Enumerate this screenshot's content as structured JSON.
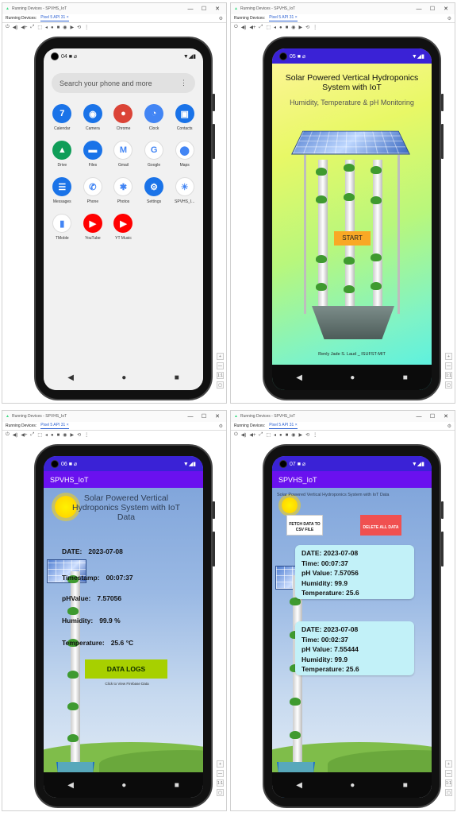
{
  "window": {
    "title": "Running Devices - SPVHS_IoT",
    "devices_label": "Running Devices:",
    "device_tab": "Pixel 5 API 31",
    "close_tab": "×",
    "min": "—",
    "max": "☐",
    "close": "✕"
  },
  "toolbar_glyphs": [
    "⏻",
    "◀)",
    "◀+",
    "⤢",
    "⬚",
    "◂",
    "●",
    "■",
    "◉",
    "▶",
    "⟲",
    "⋮"
  ],
  "side_glyphs": [
    "+",
    "—",
    "1:1",
    "▢"
  ],
  "home": {
    "status_time": "04",
    "status_icons_left": "■ ⌀",
    "status_icons_right": "▼◢▮",
    "search_placeholder": "Search your phone and more",
    "search_menu": "⋮",
    "apps": [
      {
        "label": "Calendar",
        "icon": "calendar-icon",
        "color": "#1a73e8",
        "glyph": "7"
      },
      {
        "label": "Camera",
        "icon": "camera-icon",
        "color": "#1a73e8",
        "glyph": "◉"
      },
      {
        "label": "Chrome",
        "icon": "chrome-icon",
        "color": "#db4437",
        "glyph": "●"
      },
      {
        "label": "Clock",
        "icon": "clock-icon",
        "color": "#4285f4",
        "glyph": "◔"
      },
      {
        "label": "Contacts",
        "icon": "contacts-icon",
        "color": "#1a73e8",
        "glyph": "▣"
      },
      {
        "label": "Drive",
        "icon": "drive-icon",
        "color": "#0f9d58",
        "glyph": "▲"
      },
      {
        "label": "Files",
        "icon": "files-icon",
        "color": "#1a73e8",
        "glyph": "▬"
      },
      {
        "label": "Gmail",
        "icon": "gmail-icon",
        "color": "#ffffff",
        "glyph": "M"
      },
      {
        "label": "Google",
        "icon": "google-icon",
        "color": "#ffffff",
        "glyph": "G"
      },
      {
        "label": "Maps",
        "icon": "maps-icon",
        "color": "#ffffff",
        "glyph": "⬤"
      },
      {
        "label": "Messages",
        "icon": "messages-icon",
        "color": "#1a73e8",
        "glyph": "☰"
      },
      {
        "label": "Phone",
        "icon": "phone-icon",
        "color": "#ffffff",
        "glyph": "✆"
      },
      {
        "label": "Photos",
        "icon": "photos-icon",
        "color": "#ffffff",
        "glyph": "✱"
      },
      {
        "label": "Settings",
        "icon": "settings-icon",
        "color": "#1a73e8",
        "glyph": "⚙"
      },
      {
        "label": "SPVHS_I...",
        "icon": "spvhs-app-icon",
        "color": "#ffffff",
        "glyph": "☀"
      },
      {
        "label": "TMoble",
        "icon": "tmobile-icon",
        "color": "#ffffff",
        "glyph": "▮"
      },
      {
        "label": "YouTube",
        "icon": "youtube-icon",
        "color": "#ff0000",
        "glyph": "▶"
      },
      {
        "label": "YT Music",
        "icon": "yt-music-icon",
        "color": "#ff0000",
        "glyph": "▶"
      }
    ]
  },
  "nav": {
    "back": "◀",
    "home": "●",
    "recents": "■"
  },
  "splash": {
    "status_time": "05",
    "status_icons_left": "■ ⌀",
    "status_icons_right": "▼◢▮",
    "title": "Solar Powered Vertical Hydroponics System with IoT",
    "subtitle": "Humidity, Temperature & pH Monitoring",
    "start_label": "START",
    "author": "Renly Jade S. Laud _ ISUFST-MIT"
  },
  "reading": {
    "status_time": "06",
    "status_icons_left": "■ ⌀",
    "status_icons_right": "▼◢▮",
    "app_title": "SPVHS_IoT",
    "title": "Solar Powered Vertical Hydroponics System with IoT Data",
    "date_label": "DATE:",
    "date_value": "2023-07-08",
    "timestamp_label": "Timestamp:",
    "timestamp_value": "00:07:37",
    "ph_label": "pHValue:",
    "ph_value": "7.57056",
    "humidity_label": "Humidity:",
    "humidity_value": "99.9 %",
    "temperature_label": "Temperature:",
    "temperature_value": "25.6 °C",
    "logs_button": "DATA LOGS",
    "logs_note": "Click to View Firebase Data"
  },
  "logs": {
    "status_time": "07",
    "status_icons_left": "■ ⌀",
    "status_icons_right": "▼◢▮",
    "app_title": "SPVHS_IoT",
    "title": "Solar Powered Vertical Hydroponics System with IoT Data",
    "fetch_button": "FETCH DATA TO CSV FILE",
    "delete_button": "DELETE ALL DATA",
    "records": [
      {
        "date": "DATE: 2023-07-08",
        "time": "Time: 00:07:37",
        "ph": "pH Value: 7.57056",
        "humidity": "Humidity: 99.9",
        "temperature": "Temperature: 25.6"
      },
      {
        "date": "DATE: 2023-07-08",
        "time": "Time: 00:02:37",
        "ph": "pH Value: 7.55444",
        "humidity": "Humidity: 99.9",
        "temperature": "Temperature: 25.6"
      }
    ]
  }
}
